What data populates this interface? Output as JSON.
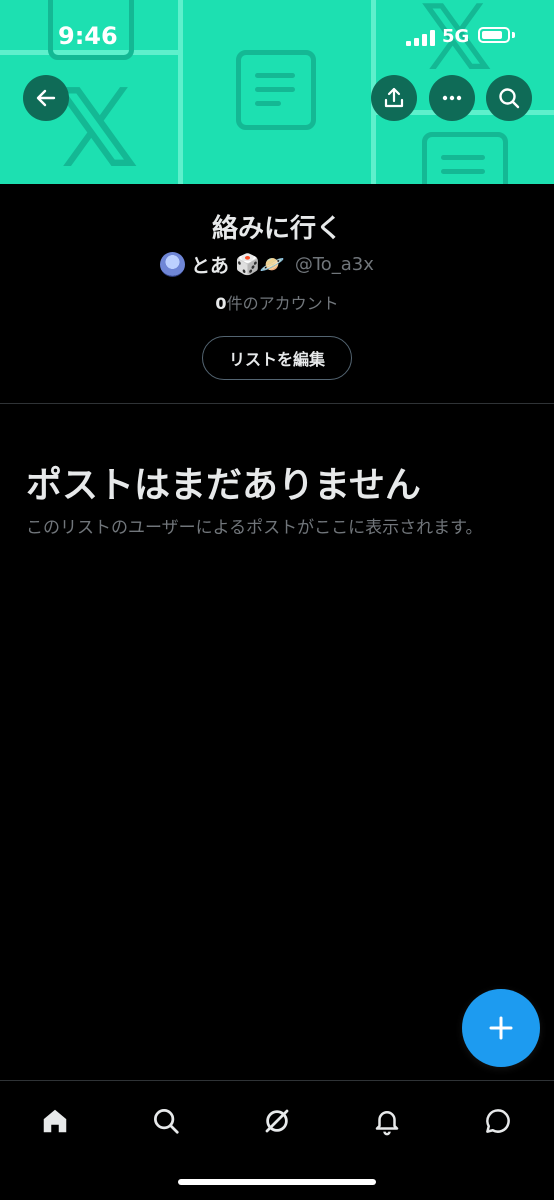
{
  "status_bar": {
    "time": "9:46",
    "network": "5G",
    "battery_level": 0.85
  },
  "header": {
    "back_icon": "arrow-left-icon",
    "actions": [
      {
        "name": "share-button",
        "icon": "share-icon"
      },
      {
        "name": "more-button",
        "icon": "more-horizontal-icon"
      },
      {
        "name": "search-button",
        "icon": "search-icon"
      }
    ],
    "banner_color": "#1de0b1"
  },
  "list": {
    "title": "絡みに行く",
    "owner_name": "とあ",
    "owner_emojis": "🎲🪐",
    "owner_handle": "@To_a3x",
    "member_count": "0",
    "member_label": "件のアカウント",
    "edit_label": "リストを編集"
  },
  "empty_state": {
    "title": "ポストはまだありません",
    "description": "このリストのユーザーによるポストがここに表示されます。"
  },
  "fab": {
    "icon": "plus-icon",
    "color": "#1d9bf0"
  },
  "bottom_nav": {
    "items": [
      {
        "name": "home",
        "icon": "home-icon",
        "active": true
      },
      {
        "name": "explore",
        "icon": "search-icon",
        "active": false
      },
      {
        "name": "grok",
        "icon": "grok-icon",
        "active": false
      },
      {
        "name": "notifications",
        "icon": "bell-icon",
        "active": false
      },
      {
        "name": "messages",
        "icon": "message-icon",
        "active": false
      }
    ]
  }
}
